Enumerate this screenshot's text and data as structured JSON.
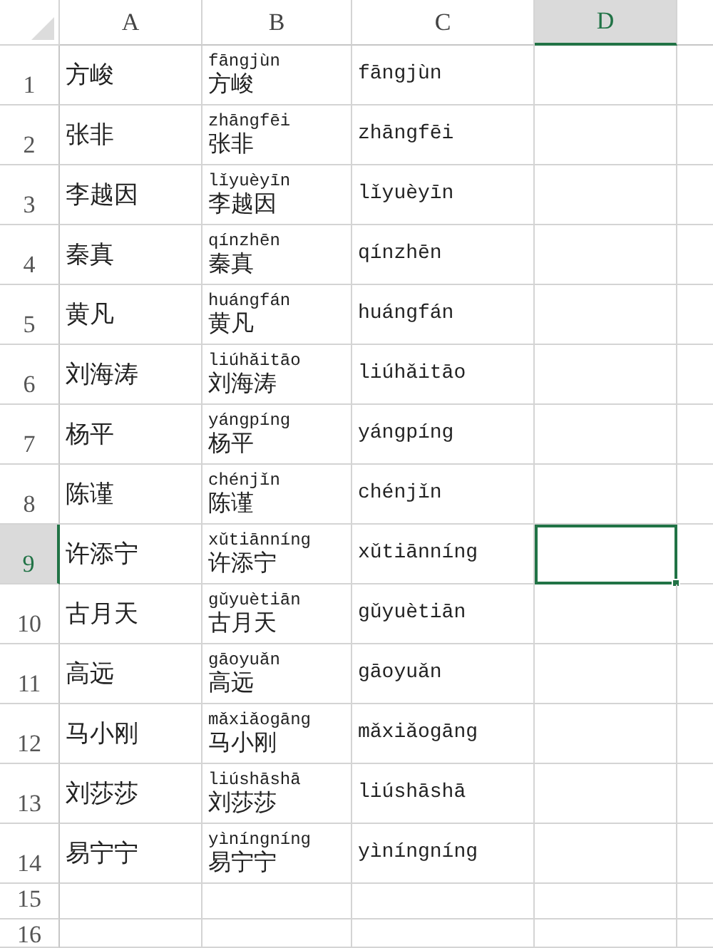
{
  "columns": [
    {
      "label": "A",
      "selected": false
    },
    {
      "label": "B",
      "selected": false
    },
    {
      "label": "C",
      "selected": false
    },
    {
      "label": "D",
      "selected": true
    }
  ],
  "rows": [
    {
      "number": "1",
      "selected": false,
      "name": "方峻",
      "phonetic": "fāngjùn",
      "name_b": "方峻",
      "pinyin": "fāngjùn",
      "d_selected": false
    },
    {
      "number": "2",
      "selected": false,
      "name": "张非",
      "phonetic": "zhāngfēi",
      "name_b": "张非",
      "pinyin": "zhāngfēi",
      "d_selected": false
    },
    {
      "number": "3",
      "selected": false,
      "name": "李越因",
      "phonetic": "lǐyuèyīn",
      "name_b": "李越因",
      "pinyin": "lǐyuèyīn",
      "d_selected": false
    },
    {
      "number": "4",
      "selected": false,
      "name": "秦真",
      "phonetic": "qínzhēn",
      "name_b": "秦真",
      "pinyin": "qínzhēn",
      "d_selected": false
    },
    {
      "number": "5",
      "selected": false,
      "name": "黄凡",
      "phonetic": "huángfán",
      "name_b": "黄凡",
      "pinyin": "huángfán",
      "d_selected": false
    },
    {
      "number": "6",
      "selected": false,
      "name": "刘海涛",
      "phonetic": "liúhǎitāo",
      "name_b": "刘海涛",
      "pinyin": "liúhǎitāo",
      "d_selected": false
    },
    {
      "number": "7",
      "selected": false,
      "name": "杨平",
      "phonetic": "yángpíng",
      "name_b": "杨平",
      "pinyin": "yángpíng",
      "d_selected": false
    },
    {
      "number": "8",
      "selected": false,
      "name": "陈谨",
      "phonetic": "chénjǐn",
      "name_b": "陈谨",
      "pinyin": "chénjǐn",
      "d_selected": false
    },
    {
      "number": "9",
      "selected": true,
      "name": "许添宁",
      "phonetic": "xǔtiānníng",
      "name_b": "许添宁",
      "pinyin": "xǔtiānníng",
      "d_selected": true
    },
    {
      "number": "10",
      "selected": false,
      "name": "古月天",
      "phonetic": "gǔyuètiān",
      "name_b": "古月天",
      "pinyin": "gǔyuètiān",
      "d_selected": false
    },
    {
      "number": "11",
      "selected": false,
      "name": "高远",
      "phonetic": "gāoyuǎn",
      "name_b": "高远",
      "pinyin": "gāoyuǎn",
      "d_selected": false
    },
    {
      "number": "12",
      "selected": false,
      "name": "马小刚",
      "phonetic": "mǎxiǎogāng",
      "name_b": "马小刚",
      "pinyin": "mǎxiǎogāng",
      "d_selected": false
    },
    {
      "number": "13",
      "selected": false,
      "name": "刘莎莎",
      "phonetic": "liúshāshā",
      "name_b": "刘莎莎",
      "pinyin": "liúshāshā",
      "d_selected": false
    },
    {
      "number": "14",
      "selected": false,
      "name": "易宁宁",
      "phonetic": "yìníngníng",
      "name_b": "易宁宁",
      "pinyin": "yìníngníng",
      "d_selected": false
    }
  ],
  "empty_rows": [
    "15",
    "16"
  ]
}
